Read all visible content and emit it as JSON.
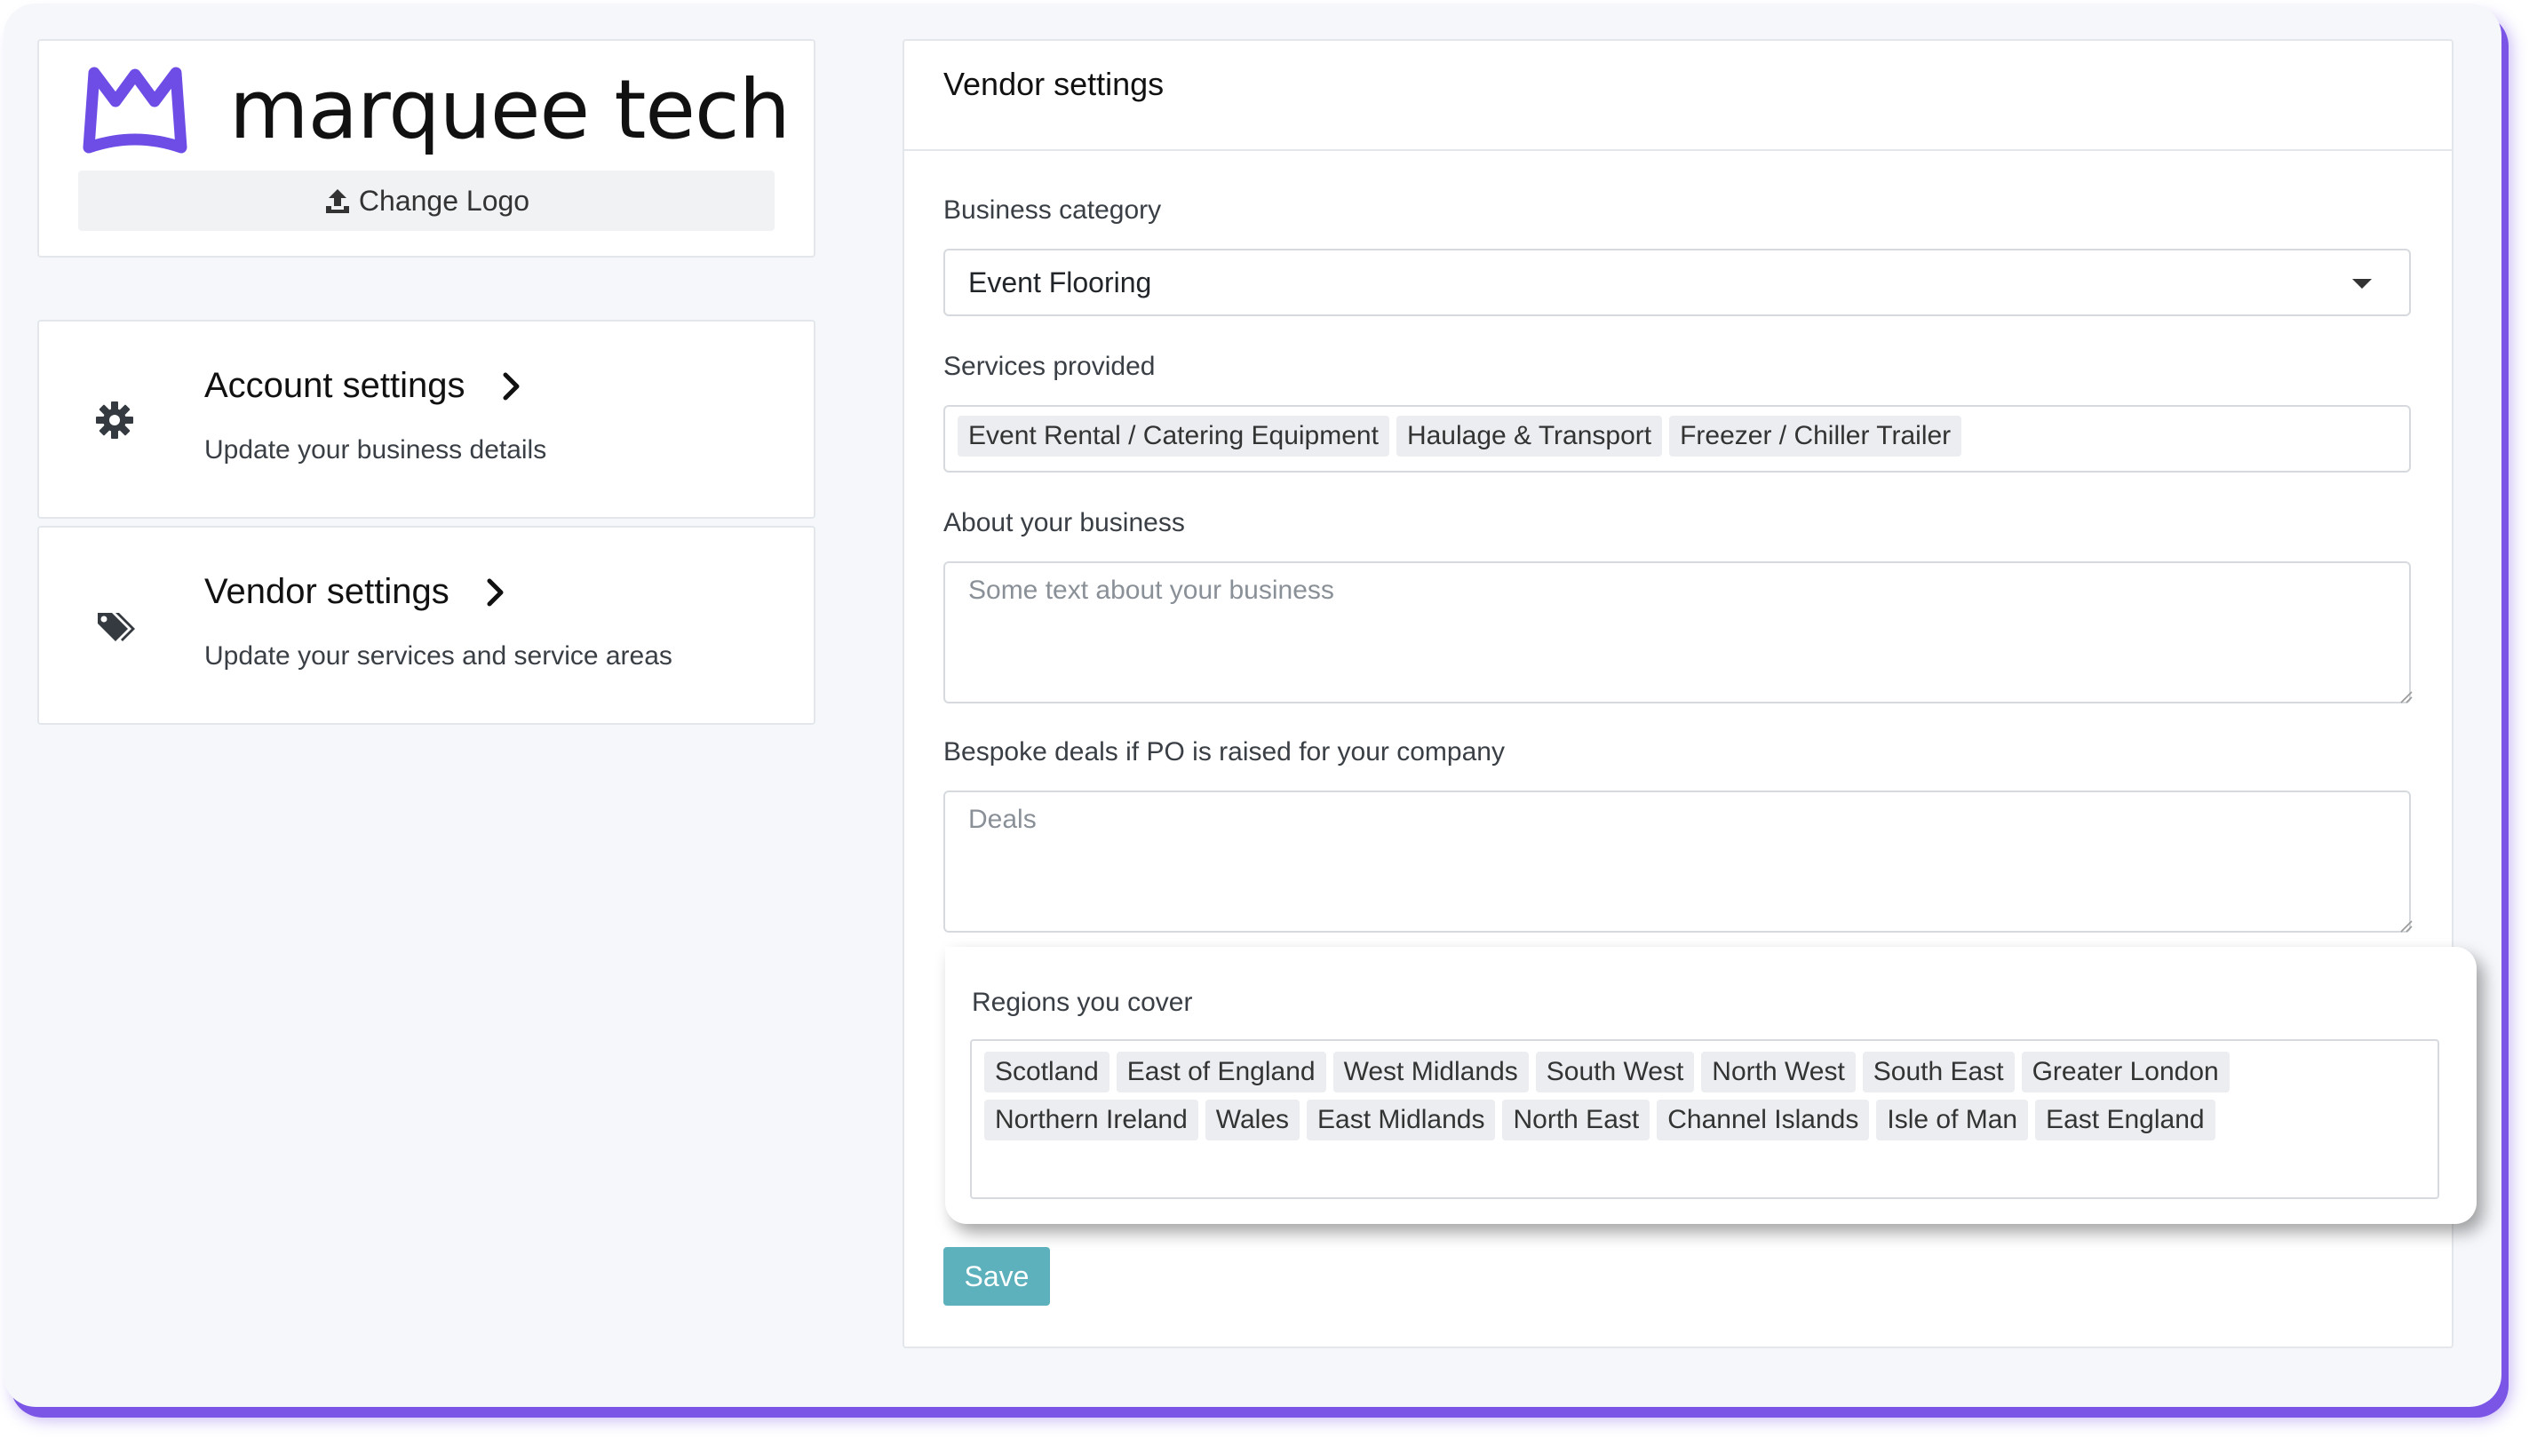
{
  "brand": {
    "name": "marquee tech",
    "change_logo_label": "Change Logo",
    "accent_color": "#6e4de6"
  },
  "nav": [
    {
      "title": "Account settings",
      "description": "Update your business details",
      "icon": "gear-icon"
    },
    {
      "title": "Vendor settings",
      "description": "Update your services and service areas",
      "icon": "tags-icon"
    }
  ],
  "vendor": {
    "title": "Vendor settings",
    "business_category": {
      "label": "Business category",
      "value": "Event Flooring"
    },
    "services": {
      "label": "Services provided",
      "tags": [
        "Event Rental / Catering Equipment",
        "Haulage & Transport",
        "Freezer / Chiller Trailer"
      ]
    },
    "about": {
      "label": "About your business",
      "placeholder": "Some text about your business"
    },
    "deals": {
      "label": "Bespoke deals if PO is raised for your company",
      "placeholder": "Deals"
    },
    "regions": {
      "label": "Regions you cover",
      "tags": [
        "Scotland",
        "East of England",
        "West Midlands",
        "South West",
        "North West",
        "South East",
        "Greater London",
        "Northern Ireland",
        "Wales",
        "East Midlands",
        "North East",
        "Channel Islands",
        "Isle of Man",
        "East England"
      ]
    },
    "save_label": "Save",
    "save_color": "#5cb1bd"
  }
}
